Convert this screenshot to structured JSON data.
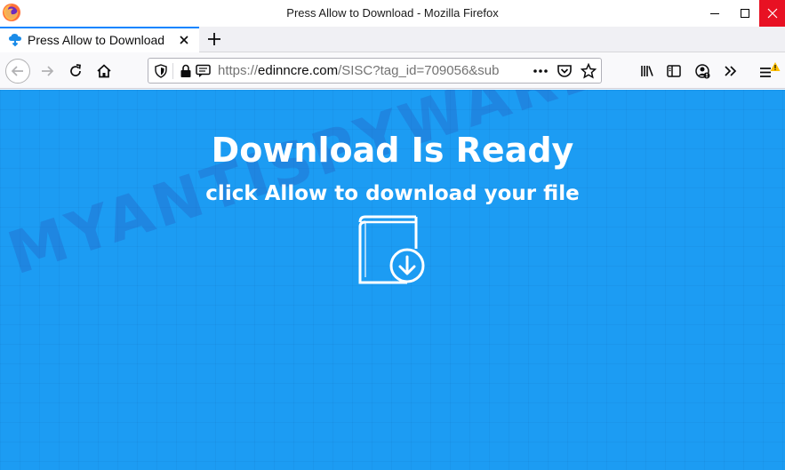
{
  "window": {
    "title": "Press Allow to Download - Mozilla Firefox",
    "app_icon": "firefox-icon",
    "controls": [
      "minimize-icon",
      "maximize-icon",
      "close-icon"
    ]
  },
  "tabs": [
    {
      "label": "Press Allow to Download",
      "favicon": "download-cloud-icon",
      "active": true
    }
  ],
  "new_tab_icon": "plus-icon",
  "navbar": {
    "url": {
      "protocol": "https://",
      "host": "edinncre.com",
      "path": "/SISC?tag_id=709056&sub"
    },
    "left_icons": [
      "back-arrow-icon",
      "forward-arrow-icon",
      "reload-icon",
      "home-icon"
    ],
    "url_icons": [
      "shield-icon",
      "lock-icon",
      "permissions-icon",
      "more-dots-icon",
      "pocket-icon",
      "star-icon"
    ],
    "right_icons": [
      "library-icon",
      "sidebar-icon",
      "account-icon",
      "overflow-chevron-icon",
      "menu-icon"
    ]
  },
  "page": {
    "headline": "Download Is Ready",
    "subline": "click Allow to download your file",
    "icon": "book-download-icon",
    "watermark": "MYANTISPYWARE.COM",
    "colors": {
      "background": "#1c9cf3",
      "text": "#ffffff",
      "close_button": "#e81123",
      "tab_accent": "#0a84ff"
    }
  }
}
